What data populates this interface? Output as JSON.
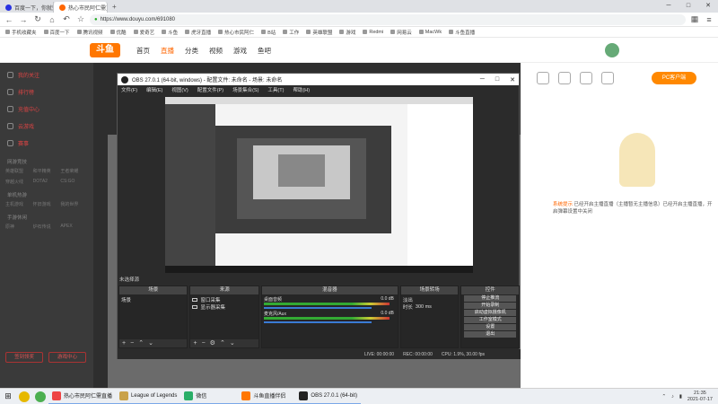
{
  "browser": {
    "tabs": [
      {
        "label": "百度一下，你就知道",
        "active": false
      },
      {
        "label": "热心市民阿仁需直播_英雄联盟直播",
        "active": true
      }
    ],
    "url": "https://www.douyu.com/691080",
    "bookmarks": [
      "手机收藏夹",
      "百度一下",
      "腾讯视频",
      "优酷",
      "爱奇艺",
      "斗鱼",
      "虎牙直播",
      "热心市民阿仁",
      "B站",
      "工作",
      "英雄联盟",
      "游戏",
      "Redmi",
      "网易云",
      "MacWk",
      "斗鱼直播"
    ]
  },
  "douyu": {
    "logo": "斗鱼",
    "nav": [
      "首页",
      "直播",
      "分类",
      "视频",
      "游戏",
      "鱼吧"
    ],
    "nav_active": "直播",
    "sidebar": {
      "items": [
        "我的关注",
        "排行榜",
        "充值中心",
        "云游戏",
        "赛事"
      ],
      "sections": [
        "网游竞技",
        "单机热游",
        "手游休闲"
      ],
      "grid": [
        "英雄联盟",
        "和平精英",
        "王者荣耀",
        "穿越火线",
        "DOTA2",
        "CS:GO",
        "主机游戏",
        "怀旧游戏",
        "我的世界",
        "原神",
        "炉石传说",
        "APEX"
      ],
      "bottom_buttons": [
        "签到领奖",
        "游戏中心"
      ]
    },
    "right": {
      "pc_button": "PC客户端",
      "notice_label": "系统提示",
      "notice_text": "已经开启主播直播（主播暂无主播信息）已经开启主播直播，开启弹幕设置中关闭"
    }
  },
  "obs": {
    "title": "OBS 27.0.1 (64-bit, windows) - 配置文件: 未命名 - 场景: 未命名",
    "menu": [
      "文件(F)",
      "编辑(E)",
      "视图(V)",
      "配置文件(P)",
      "场景集合(S)",
      "工具(T)",
      "帮助(H)"
    ],
    "no_source_selected": "未选择源",
    "docks": {
      "scenes": {
        "title": "场景",
        "items": [
          "场景"
        ]
      },
      "sources": {
        "title": "来源",
        "items": [
          "窗口采集",
          "显示器采集"
        ]
      },
      "mixer": {
        "title": "混音器",
        "tracks": [
          "桌面音频",
          "麦克风/Aux"
        ],
        "levels": [
          "0.0 dB",
          "0.0 dB"
        ]
      },
      "transitions": {
        "title": "场景转场",
        "type": "淡出",
        "duration_label": "时长",
        "duration": "300 ms"
      },
      "controls": {
        "title": "控件",
        "buttons": [
          "停止推流",
          "开始录制",
          "启动虚拟摄像机",
          "工作室模式",
          "设置",
          "退出"
        ]
      }
    },
    "status": {
      "live": "LIVE: 00:00:00",
      "rec": "REC: 00:00:00",
      "cpu": "CPU: 1.9%, 30.00 fps"
    }
  },
  "taskbar": {
    "apps": [
      "热心市民阿仁需直播",
      "League of Legends",
      "微信",
      "斗鱼直播伴侣",
      "OBS 27.0.1 (64-bit)"
    ],
    "time": "21:35",
    "date": "2021-07-17"
  },
  "colors": {
    "accent": "#ff7700",
    "obs_bg": "#2b2b2b",
    "sidebar_bg": "#3a3a3a"
  }
}
